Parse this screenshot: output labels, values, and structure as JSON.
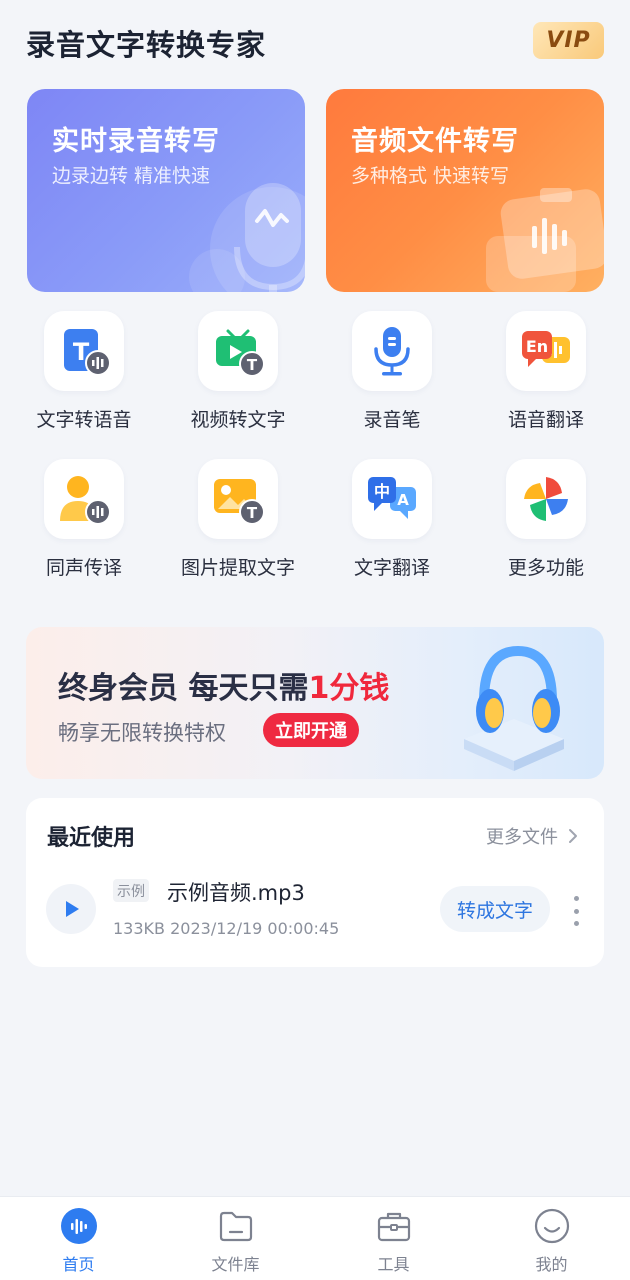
{
  "header": {
    "title": "录音文字转换专家",
    "vip_label": "VIP"
  },
  "feature_cards": [
    {
      "title": "实时录音转写",
      "subtitle": "边录边转 精准快速",
      "icon": "microphone-icon"
    },
    {
      "title": "音频文件转写",
      "subtitle": "多种格式 快速转写",
      "icon": "audio-file-icon"
    }
  ],
  "tools": [
    {
      "label": "文字转语音",
      "icon": "text-to-speech-icon"
    },
    {
      "label": "视频转文字",
      "icon": "video-to-text-icon"
    },
    {
      "label": "录音笔",
      "icon": "microphone-icon"
    },
    {
      "label": "语音翻译",
      "icon": "voice-translate-icon"
    },
    {
      "label": "同声传译",
      "icon": "simultaneous-interpretation-icon"
    },
    {
      "label": "图片提取文字",
      "icon": "image-to-text-icon"
    },
    {
      "label": "文字翻译",
      "icon": "text-translate-icon"
    },
    {
      "label": "更多功能",
      "icon": "pinwheel-icon"
    }
  ],
  "banner": {
    "line1_prefix": "终身会员  每天只需",
    "line1_highlight": "1分钱",
    "line2": "畅享无限转换特权",
    "button_label": "立即开通",
    "image": "headphones-icon"
  },
  "recent": {
    "title": "最近使用",
    "more_label": "更多文件",
    "items": [
      {
        "tag": "示例",
        "name": "示例音频.mp3",
        "meta": "133KB 2023/12/19 00:00:45",
        "action_label": "转成文字"
      }
    ]
  },
  "bottom_nav": {
    "active": 0,
    "items": [
      {
        "label": "首页",
        "icon": "home-audio-icon"
      },
      {
        "label": "文件库",
        "icon": "folder-icon"
      },
      {
        "label": "工具",
        "icon": "toolbox-icon"
      },
      {
        "label": "我的",
        "icon": "smiley-icon"
      }
    ]
  },
  "colors": {
    "accent_blue": "#2E7CF0",
    "accent_red": "#EF2A41",
    "card_purple": "#8A9BF8",
    "card_orange": "#FF8E45",
    "background": "#F3F5F9"
  }
}
